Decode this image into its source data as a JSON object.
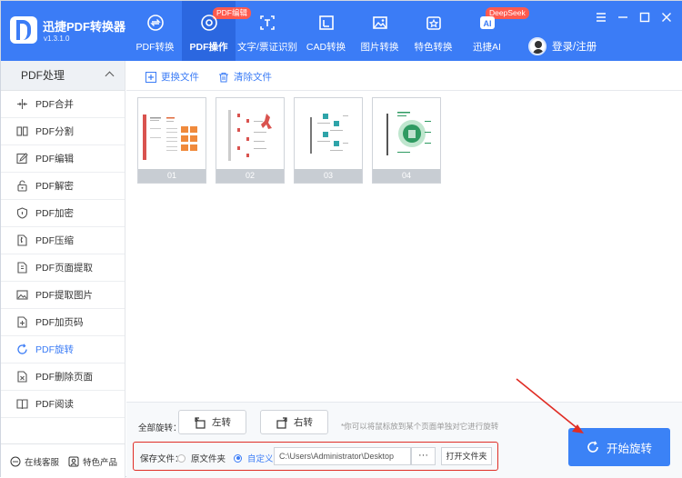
{
  "app": {
    "title": "迅捷PDF转换器",
    "version": "v1.3.1.0"
  },
  "nav": [
    {
      "label": "PDF转换",
      "icon": "pdf-convert-icon"
    },
    {
      "label": "PDF操作",
      "icon": "pdf-operate-icon",
      "badge": "PDF编辑",
      "active": true
    },
    {
      "label": "文字/票证识别",
      "icon": "ocr-icon"
    },
    {
      "label": "CAD转换",
      "icon": "cad-icon"
    },
    {
      "label": "图片转换",
      "icon": "image-icon"
    },
    {
      "label": "特色转换",
      "icon": "star-icon"
    },
    {
      "label": "迅捷AI",
      "icon": "ai-icon",
      "badge": "DeepSeek"
    }
  ],
  "user": {
    "login_label": "登录/注册"
  },
  "sidebar": {
    "header": "PDF处理",
    "items": [
      {
        "label": "PDF合并",
        "icon": "merge-icon"
      },
      {
        "label": "PDF分割",
        "icon": "split-icon"
      },
      {
        "label": "PDF编辑",
        "icon": "edit-icon"
      },
      {
        "label": "PDF解密",
        "icon": "unlock-icon"
      },
      {
        "label": "PDF加密",
        "icon": "shield-icon"
      },
      {
        "label": "PDF压缩",
        "icon": "compress-icon"
      },
      {
        "label": "PDF页面提取",
        "icon": "page-extract-icon"
      },
      {
        "label": "PDF提取图片",
        "icon": "image-extract-icon"
      },
      {
        "label": "PDF加页码",
        "icon": "page-number-icon"
      },
      {
        "label": "PDF旋转",
        "icon": "rotate-icon",
        "active": true
      },
      {
        "label": "PDF删除页面",
        "icon": "delete-page-icon"
      },
      {
        "label": "PDF阅读",
        "icon": "book-icon"
      }
    ],
    "online_service": "在线客服",
    "featured": "特色产品"
  },
  "toolbar": {
    "replace_file": "更换文件",
    "clear_file": "清除文件"
  },
  "pages": [
    "01",
    "02",
    "03",
    "04"
  ],
  "rotate": {
    "all_label": "全部旋转：",
    "left": "左转",
    "right": "右转",
    "hint": "*你可以将鼠标放到某个页面单独对它进行旋转"
  },
  "save": {
    "label": "保存文件：",
    "original": "原文件夹",
    "custom": "自定义",
    "path": "C:\\Users\\Administrator\\Desktop",
    "browse": "···",
    "open_folder": "打开文件夹",
    "selected": "custom"
  },
  "start_button": "开始旋转",
  "colors": {
    "header": "#3b7cf6",
    "accent": "#3b82f6",
    "highlight": "#e02d25"
  }
}
